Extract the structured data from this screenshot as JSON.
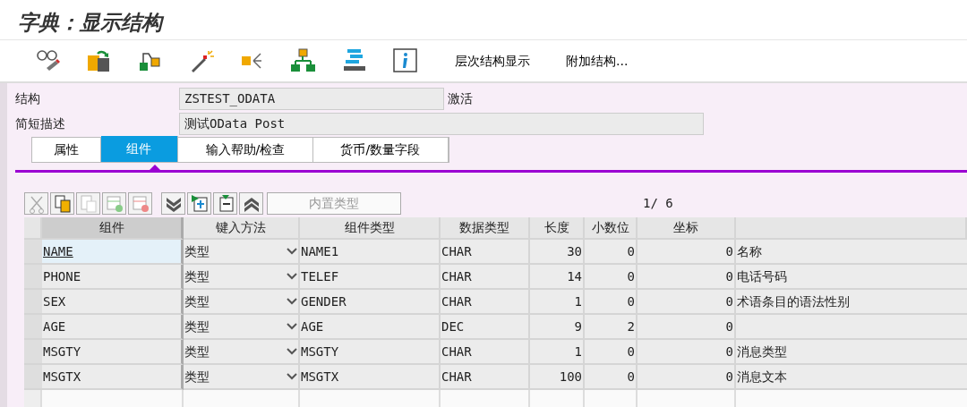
{
  "window": {
    "title": "字典：显示结构"
  },
  "toolbar": {
    "text_buttons": [
      "层次结构显示",
      "附加结构..."
    ]
  },
  "fields": [
    {
      "label": "结构",
      "value": "ZSTEST_ODATA",
      "status": "激活",
      "kind": "short"
    },
    {
      "label": "简短描述",
      "value": "测试OData Post",
      "kind": "long"
    }
  ],
  "tabs": [
    {
      "label": "属性",
      "selected": false
    },
    {
      "label": "组件",
      "selected": true
    },
    {
      "label": "输入帮助/检查",
      "selected": false
    },
    {
      "label": "货币/数量字段",
      "selected": false
    }
  ],
  "table_toolbar": {
    "builtin_type_button": "内置类型",
    "page_counter": "1/ 6"
  },
  "table": {
    "columns": [
      "组件",
      "键入方法",
      "组件类型",
      "数据类型",
      "长度",
      "小数位",
      "坐标"
    ],
    "rows": [
      {
        "component": "NAME",
        "input_method": "类型",
        "component_type": "NAME1",
        "data_type": "CHAR",
        "length": "30",
        "decimals": "0",
        "coordinate": "0",
        "description": "名称",
        "focused": true
      },
      {
        "component": "PHONE",
        "input_method": "类型",
        "component_type": "TELEF",
        "data_type": "CHAR",
        "length": "14",
        "decimals": "0",
        "coordinate": "0",
        "description": "电话号码",
        "focused": false
      },
      {
        "component": "SEX",
        "input_method": "类型",
        "component_type": "GENDER",
        "data_type": "CHAR",
        "length": "1",
        "decimals": "0",
        "coordinate": "0",
        "description": "术语条目的语法性别",
        "focused": false
      },
      {
        "component": "AGE",
        "input_method": "类型",
        "component_type": "AGE",
        "data_type": "DEC",
        "length": "9",
        "decimals": "2",
        "coordinate": "0",
        "focused": false
      },
      {
        "component": "MSGTY",
        "input_method": "类型",
        "component_type": "MSGTY",
        "data_type": "CHAR",
        "length": "1",
        "decimals": "0",
        "coordinate": "0",
        "description": "消息类型",
        "focused": false
      },
      {
        "component": "MSGTX",
        "input_method": "类型",
        "component_type": "MSGTX",
        "data_type": "CHAR",
        "length": "100",
        "decimals": "0",
        "coordinate": "0",
        "description": "消息文本",
        "focused": false
      }
    ]
  }
}
